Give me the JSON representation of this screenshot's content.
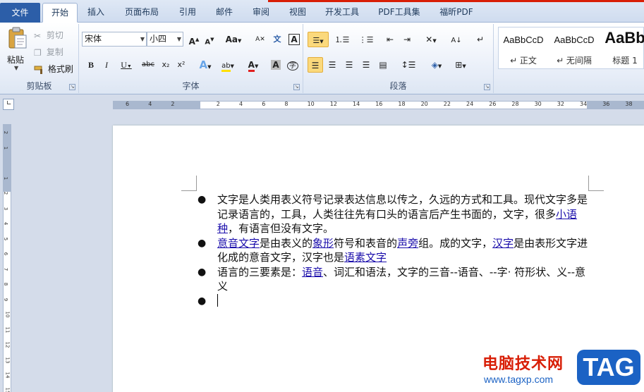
{
  "tabs": [
    "文件",
    "开始",
    "插入",
    "页面布局",
    "引用",
    "邮件",
    "审阅",
    "视图",
    "开发工具",
    "PDF工具集",
    "福昕PDF"
  ],
  "active_tab": "开始",
  "clipboard": {
    "paste": "粘贴",
    "cut": "剪切",
    "copy": "复制",
    "format_painter": "格式刷",
    "label": "剪贴板"
  },
  "font": {
    "name": "宋体",
    "size": "小四",
    "grow": "A",
    "shrink": "A",
    "case": "Aa",
    "bold": "B",
    "italic": "I",
    "underline": "U",
    "strike": "abc",
    "sub": "x₂",
    "sup": "x²",
    "font_color_letter": "A",
    "label": "字体"
  },
  "paragraph": {
    "label": "段落"
  },
  "styles": [
    {
      "preview": "AaBbCcD",
      "name": "↵ 正文"
    },
    {
      "preview": "AaBbCcD",
      "name": "↵ 无间隔"
    },
    {
      "preview": "AaBb",
      "name": "标题 1"
    }
  ],
  "ruler": {
    "h_numbers": [
      "6",
      "4",
      "2",
      "",
      "2",
      "4",
      "6",
      "8",
      "10",
      "12",
      "14",
      "16",
      "18",
      "20",
      "22",
      "24",
      "26",
      "28",
      "30",
      "32",
      "34",
      "36",
      "38"
    ],
    "v_numbers": [
      "2",
      "1",
      "",
      "1",
      "2",
      "3",
      "4",
      "5",
      "6",
      "7",
      "8",
      "9",
      "10",
      "11",
      "12",
      "13",
      "14",
      "15"
    ]
  },
  "document": {
    "items": [
      {
        "parts": [
          {
            "text": "文字是人类用表义符号记录表达信息以传之，久远的方式和工具。现代文字多是记录语言的，工具，人类往往先有口头的语言后产生书面的，文字，很多",
            "link": false
          },
          {
            "text": "小语种",
            "link": true
          },
          {
            "text": "，有语言但没有文字。",
            "link": false
          }
        ]
      },
      {
        "parts": [
          {
            "text": "意音文字",
            "link": true
          },
          {
            "text": "是由表义的",
            "link": false
          },
          {
            "text": "象形",
            "link": true
          },
          {
            "text": "符号和表音的",
            "link": false
          },
          {
            "text": "声旁",
            "link": true
          },
          {
            "text": "组。成的文字，",
            "link": false
          },
          {
            "text": "汉字",
            "link": true
          },
          {
            "text": "是由表形文字进化成的意音文字，汉字也是",
            "link": false
          },
          {
            "text": "语素文字",
            "link": true
          }
        ]
      },
      {
        "parts": [
          {
            "text": "语言的三要素是：",
            "link": false
          },
          {
            "text": "语音",
            "link": true
          },
          {
            "text": "、词汇和语法，文字的三音--语音、--字· 符形状、义--意义",
            "link": false
          }
        ]
      },
      {
        "parts": []
      }
    ],
    "bullet": "●"
  },
  "watermark": {
    "title": "电脑技术网",
    "url": "www.tagxp.com",
    "tag": "TAG"
  },
  "colors": {
    "accent": "#2c5ea8",
    "link": "#1a0dab",
    "watermark_red": "#d81e06",
    "watermark_blue": "#1b62c4"
  }
}
